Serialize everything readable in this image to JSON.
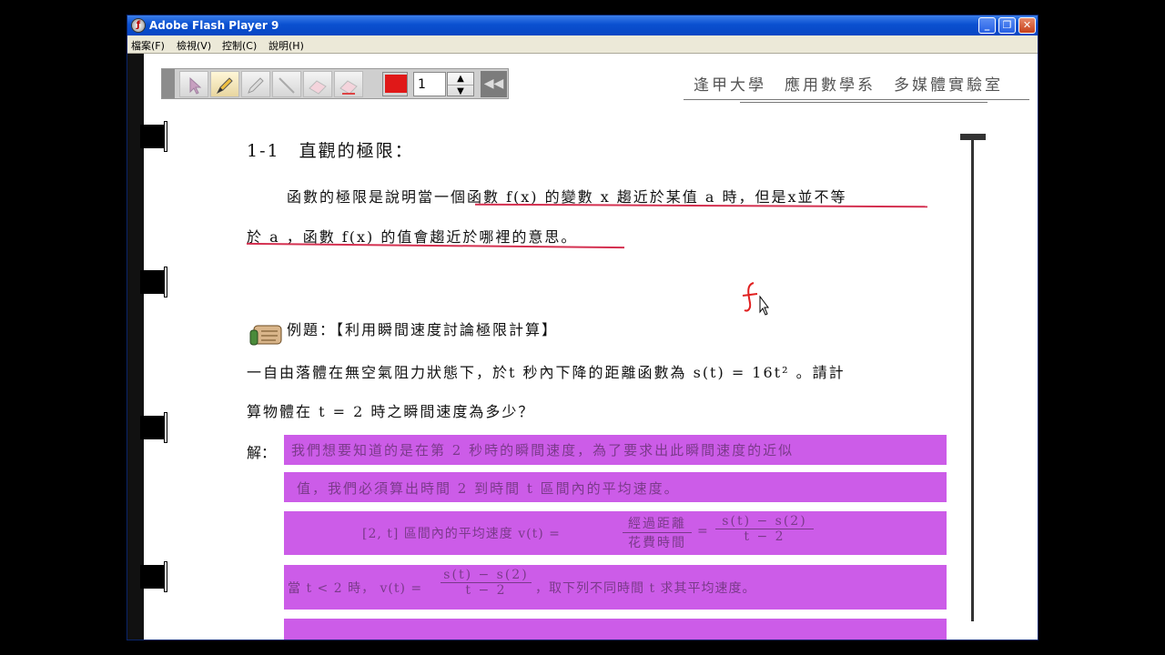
{
  "window": {
    "title": "Adobe Flash Player 9",
    "app_icon": "flash-icon"
  },
  "menu": {
    "items": [
      "檔案(F)",
      "檢視(V)",
      "控制(C)",
      "說明(H)"
    ]
  },
  "toolbar": {
    "tools": [
      "pointer-icon",
      "pencil-icon",
      "highlighter-icon",
      "line-icon",
      "eraser-icon",
      "clear-eraser-icon"
    ],
    "selected_tool": "pencil-icon",
    "pen_color": "#e01818",
    "pen_size": "1",
    "rewind_icon": "rewind-icon"
  },
  "header": {
    "text": "逢甲大學　應用數學系　多媒體實驗室"
  },
  "content": {
    "section_title": "1-1　直觀的極限：",
    "definition_line1": "函數的極限是說明當一個函數 f(x) 的變數 x 趨近於某值 a 時，但是x並不等",
    "definition_line2": "於 a ，函數 f(x) 的值會趨近於哪裡的意思。",
    "example_title": "例題：【利用瞬間速度討論極限計算】",
    "problem_line1": "一自由落體在無空氣阻力狀態下，於t 秒內下降的距離函數為 s(t) = 16t² 。請計",
    "problem_line2": "算物體在 t = 2 時之瞬間速度為多少？",
    "solution_label": "解：",
    "solution_line1": "我們想要知道的是在第 2 秒時的瞬間速度，為了要求出此瞬間速度的近似",
    "solution_line2": "值，我們必須算出時間 2 到時間 t 區間內的平均速度。",
    "avg_velocity_prefix": "[2, t] 區間內的平均速度 v(t) =",
    "frac1_num": "經過距離",
    "frac1_den": "花費時間",
    "eq_sign": "=",
    "frac2_num": "s(t) − s(2)",
    "frac2_den": "t − 2",
    "when_prefix": "當 t < 2 時，  v(t) =",
    "when_suffix": "，取下列不同時間 t 求其平均速度。",
    "handwriting": "f"
  },
  "colors": {
    "highlight": "#cc5ce8",
    "underline": "#d43050",
    "ink": "#e02020"
  }
}
